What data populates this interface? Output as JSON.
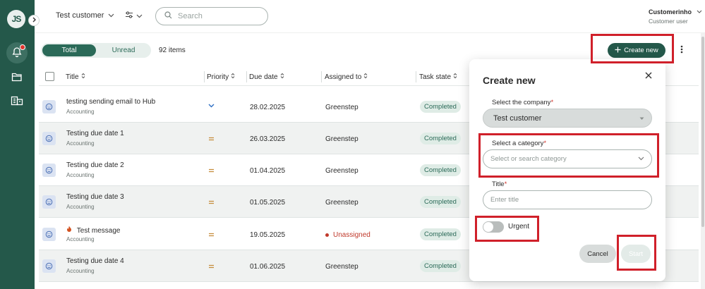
{
  "sidebar": {
    "logo_text": "JS",
    "icons": [
      "bell-icon",
      "folder-icon",
      "building-icon"
    ],
    "accent": "#24584a"
  },
  "topbar": {
    "customer_select": "Test customer",
    "search_placeholder": "Search",
    "user_name": "Customerinho",
    "user_role": "Customer user"
  },
  "filters": {
    "total_label": "Total",
    "unread_label": "Unread",
    "items_count": "92 items"
  },
  "toolbar": {
    "create_label": "Create new"
  },
  "table": {
    "headers": {
      "title": "Title",
      "priority": "Priority",
      "due_date": "Due date",
      "assigned_to": "Assigned to",
      "task_state": "Task state"
    },
    "rows": [
      {
        "title": "testing sending email to Hub",
        "category": "Accounting",
        "priority": "low",
        "due": "28.02.2025",
        "assigned": "Greenstep",
        "state": "Completed"
      },
      {
        "title": "Testing due date 1",
        "category": "Accounting",
        "priority": "medium",
        "due": "26.03.2025",
        "assigned": "Greenstep",
        "state": "Completed"
      },
      {
        "title": "Testing due date 2",
        "category": "Accounting",
        "priority": "medium",
        "due": "01.04.2025",
        "assigned": "Greenstep",
        "state": "Completed"
      },
      {
        "title": "Testing due date 3",
        "category": "Accounting",
        "priority": "medium",
        "due": "01.05.2025",
        "assigned": "Greenstep",
        "state": "Completed"
      },
      {
        "title": "Test message",
        "category": "Accounting",
        "priority": "medium",
        "due": "19.05.2025",
        "assigned": "Unassigned",
        "state": "Completed",
        "urgent": true
      },
      {
        "title": "Testing due date 4",
        "category": "Accounting",
        "priority": "medium",
        "due": "01.06.2025",
        "assigned": "Greenstep",
        "state": "Completed"
      }
    ]
  },
  "modal": {
    "title": "Create new",
    "company_label": "Select the company",
    "company_value": "Test customer",
    "category_label": "Select a category",
    "category_placeholder": "Select or search category",
    "title_label": "Title",
    "title_placeholder": "Enter title",
    "urgent_label": "Urgent",
    "urgent_on": false,
    "cancel_label": "Cancel",
    "start_label": "Start",
    "required_mark": "*"
  },
  "colors": {
    "primary": "#24584a",
    "badge_bg": "#dfece6",
    "required": "#d0342c",
    "annotation": "#d0202a",
    "priority_medium": "#c58c3a",
    "priority_low": "#2e6fc4"
  }
}
